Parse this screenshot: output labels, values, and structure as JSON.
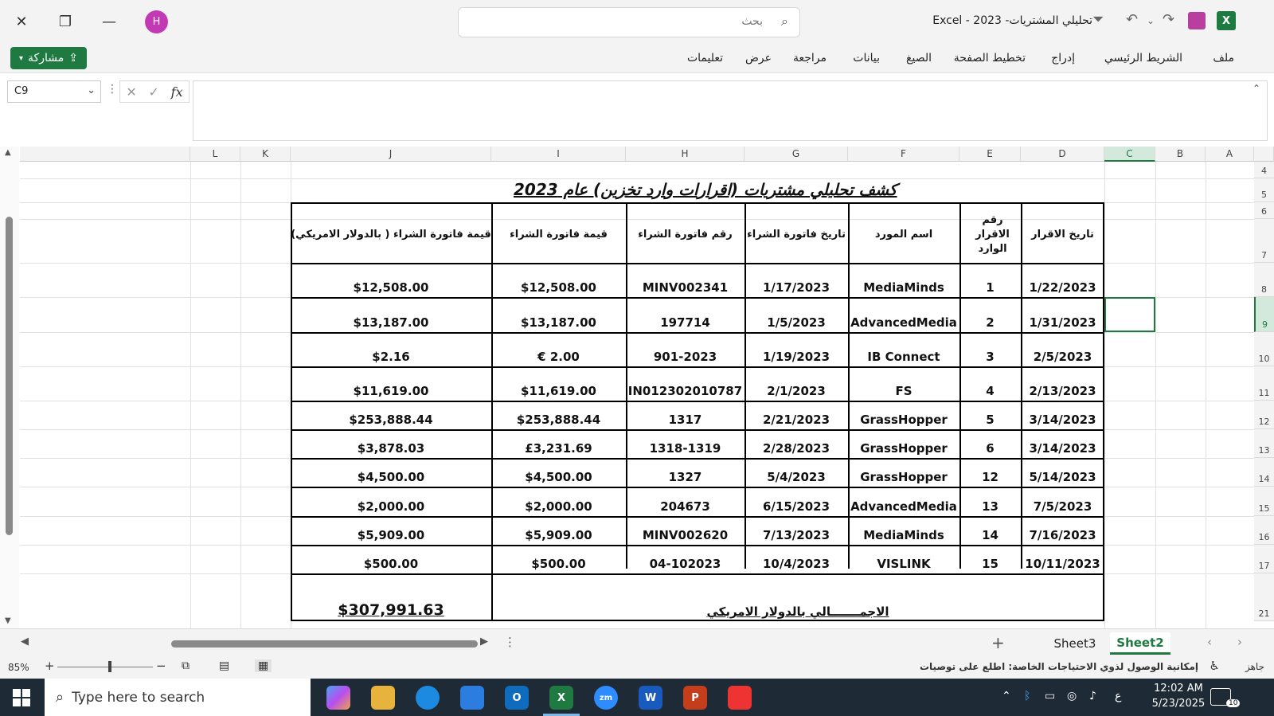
{
  "titlebar": {
    "app_title": "تحليلي المشتريات- 2023 - Excel",
    "search_placeholder": "بحث",
    "avatar_letter": "H"
  },
  "ribbon": {
    "share_label": "مشاركة",
    "tabs": [
      "ملف",
      "الشريط الرئيسي",
      "إدراج",
      "تخطيط الصفحة",
      "الصيغ",
      "بيانات",
      "مراجعة",
      "عرض",
      "تعليمات"
    ]
  },
  "formula_bar": {
    "name_box": "C9",
    "fx_label": "fx",
    "formula": ""
  },
  "columns": [
    "A",
    "B",
    "C",
    "D",
    "E",
    "F",
    "G",
    "H",
    "I",
    "J",
    "K",
    "L"
  ],
  "rows": [
    "4",
    "5",
    "6",
    "7",
    "8",
    "9",
    "10",
    "11",
    "12",
    "13",
    "14",
    "15",
    "16",
    "17",
    "21"
  ],
  "report": {
    "title": "كشف تحليلي مشتريات (اقرارات وارد تخزين) عام 2023",
    "headers": {
      "d": "تاريخ الاقرار",
      "e": "رقم الاقرار الوارد",
      "f": "اسم المورد",
      "g": "تاريخ فاتورة الشراء",
      "h": "رقم فاتورة الشراء",
      "i": "قيمة فاتورة الشراء",
      "j": "قيمة فاتورة الشراء ( بالدولار الامريكي)"
    },
    "rows": [
      {
        "d": "1/22/2023",
        "e": "1",
        "f": "MediaMinds",
        "g": "1/17/2023",
        "h": "MINV002341",
        "i": "$12,508.00",
        "j": "$12,508.00"
      },
      {
        "d": "1/31/2023",
        "e": "2",
        "f": "AdvancedMedia",
        "g": "1/5/2023",
        "h": "197714",
        "i": "$13,187.00",
        "j": "$13,187.00"
      },
      {
        "d": "2/5/2023",
        "e": "3",
        "f": "IB Connect",
        "g": "1/19/2023",
        "h": "901-2023",
        "i": "€ 2.00",
        "j": "$2.16"
      },
      {
        "d": "2/13/2023",
        "e": "4",
        "f": "FS",
        "g": "2/1/2023",
        "h": "IN012302010787",
        "i": "$11,619.00",
        "j": "$11,619.00"
      },
      {
        "d": "3/14/2023",
        "e": "5",
        "f": "GrassHopper",
        "g": "2/21/2023",
        "h": "1317",
        "i": "$253,888.44",
        "j": "$253,888.44"
      },
      {
        "d": "3/14/2023",
        "e": "6",
        "f": "GrassHopper",
        "g": "2/28/2023",
        "h": "1318-1319",
        "i": "£3,231.69",
        "j": "$3,878.03"
      },
      {
        "d": "5/14/2023",
        "e": "12",
        "f": "GrassHopper",
        "g": "5/4/2023",
        "h": "1327",
        "i": "$4,500.00",
        "j": "$4,500.00"
      },
      {
        "d": "7/5/2023",
        "e": "13",
        "f": "AdvancedMedia",
        "g": "6/15/2023",
        "h": "204673",
        "i": "$2,000.00",
        "j": "$2,000.00"
      },
      {
        "d": "7/16/2023",
        "e": "14",
        "f": "MediaMinds",
        "g": "7/13/2023",
        "h": "MINV002620",
        "i": "$5,909.00",
        "j": "$5,909.00"
      },
      {
        "d": "10/11/2023",
        "e": "15",
        "f": "VISLINK",
        "g": "10/4/2023",
        "h": "04-102023",
        "i": "$500.00",
        "j": "$500.00"
      }
    ],
    "total_label": "الاجمـــــــالي بالدولار الامريكي",
    "total_value": "$307,991.63"
  },
  "sheet_tabs": {
    "tabs": [
      "Sheet2",
      "Sheet3"
    ],
    "active": "Sheet2",
    "add_label": "+"
  },
  "status": {
    "ready": "جاهز",
    "accessibility": "إمكانية الوصول لذوي الاحتياجات الخاصة: اطلع على توصيات",
    "zoom": "85%"
  },
  "taskbar": {
    "search_placeholder": "Type here to search",
    "time": "12:02 AM",
    "date": "5/23/2025",
    "lang": "ع",
    "notif_count": "10"
  }
}
